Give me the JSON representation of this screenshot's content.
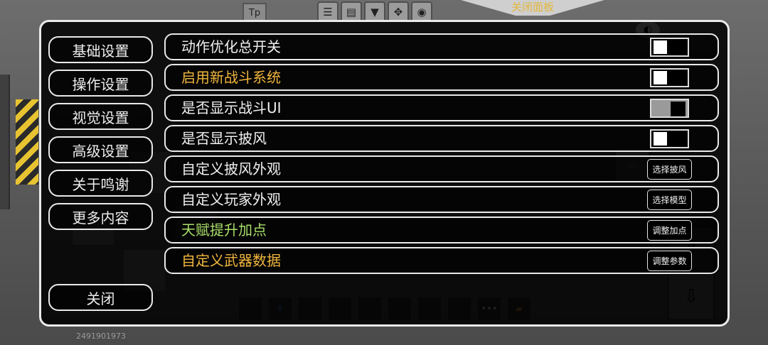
{
  "hud": {
    "tp_label": "Tp",
    "close_panel_tab": "关闭面板",
    "build_id": "2491901973",
    "more_glyph": "•••"
  },
  "panel": {
    "nav": [
      {
        "label": "基础设置"
      },
      {
        "label": "操作设置"
      },
      {
        "label": "视觉设置"
      },
      {
        "label": "高级设置"
      },
      {
        "label": "关于鸣谢"
      },
      {
        "label": "更多内容"
      }
    ],
    "close_label": "关闭",
    "rows": [
      {
        "label": "动作优化总开关",
        "color": "#f0f0f0",
        "control": "toggle",
        "state": "off"
      },
      {
        "label": "启用新战斗系统",
        "color": "#f1b63e",
        "control": "toggle",
        "state": "off"
      },
      {
        "label": "是否显示战斗UI",
        "color": "#f0f0f0",
        "control": "toggle",
        "state": "on"
      },
      {
        "label": "是否显示披风",
        "color": "#f0f0f0",
        "control": "toggle",
        "state": "off"
      },
      {
        "label": "自定义披风外观",
        "color": "#f0f0f0",
        "control": "button",
        "button_label": "选择披风"
      },
      {
        "label": "自定义玩家外观",
        "color": "#f0f0f0",
        "control": "button",
        "button_label": "选择模型"
      },
      {
        "label": "天赋提升加点",
        "color": "#a9df6a",
        "control": "button",
        "button_label": "调整加点"
      },
      {
        "label": "自定义武器数据",
        "color": "#f1b63e",
        "control": "button",
        "button_label": "调整参数"
      }
    ]
  }
}
